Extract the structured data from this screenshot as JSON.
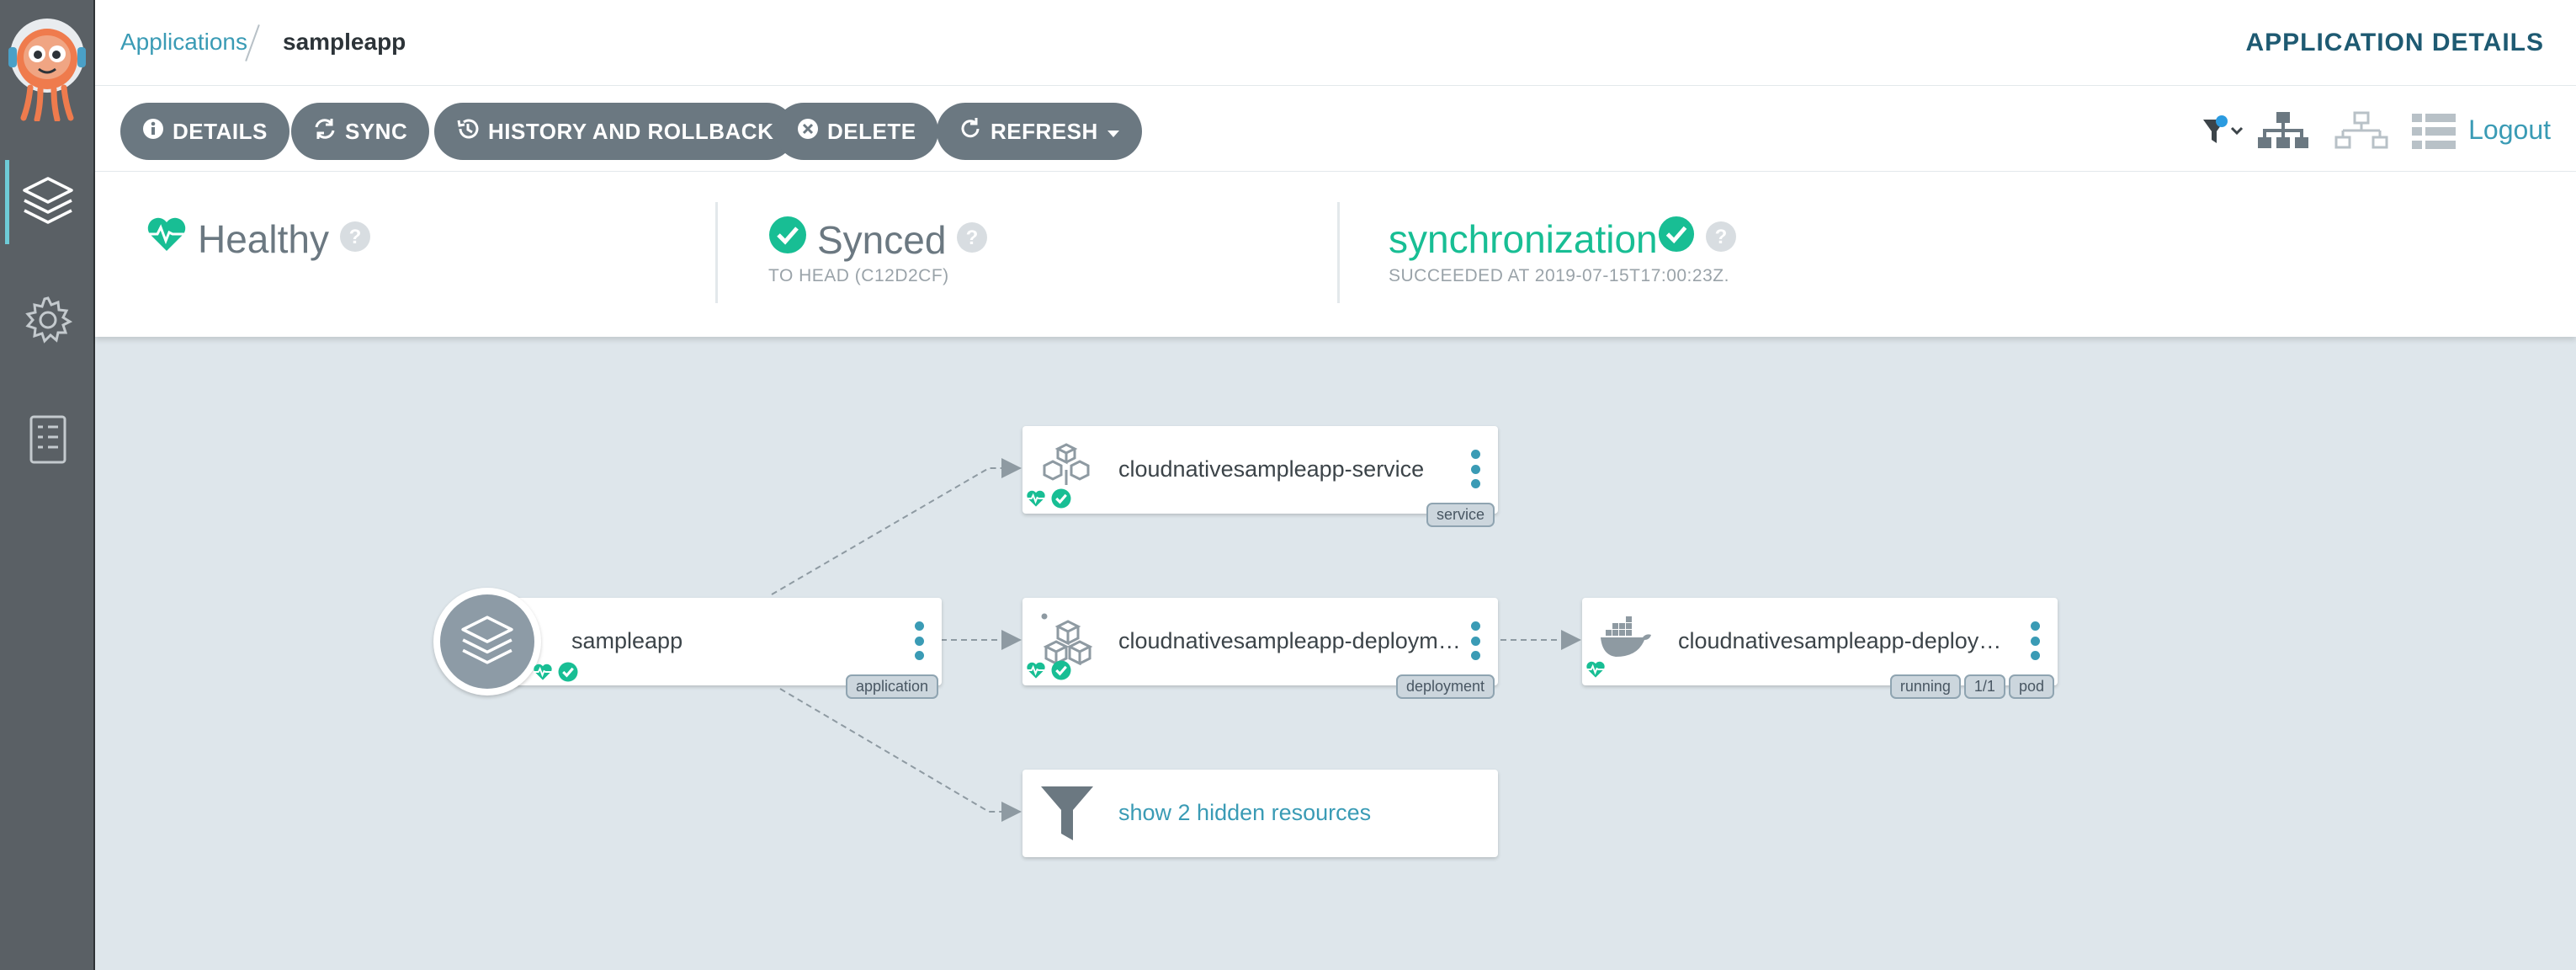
{
  "header": {
    "breadcrumb_link": "Applications",
    "breadcrumb_current": "sampleapp",
    "page_title": "APPLICATION DETAILS"
  },
  "sidebar": {
    "items": [
      {
        "icon": "layers-icon",
        "active": true
      },
      {
        "icon": "gear-icon",
        "active": false
      },
      {
        "icon": "docs-icon",
        "active": false
      }
    ]
  },
  "toolbar": {
    "buttons": [
      {
        "label": "DETAILS",
        "icon": "info-icon"
      },
      {
        "label": "SYNC",
        "icon": "sync-icon"
      },
      {
        "label": "HISTORY AND ROLLBACK",
        "icon": "history-icon"
      },
      {
        "label": "DELETE",
        "icon": "close-circle-icon"
      },
      {
        "label": "REFRESH",
        "icon": "refresh-icon"
      }
    ],
    "logout": "Logout"
  },
  "status": {
    "health": "Healthy",
    "sync": "Synced",
    "sync_sub": "TO HEAD (C12D2CF)",
    "operation": "synchronization",
    "operation_sub": "SUCCEEDED AT 2019-07-15T17:00:23Z."
  },
  "graph": {
    "app_node": {
      "label": "sampleapp",
      "tags": [
        "application"
      ]
    },
    "service_node": {
      "label": "cloudnativesampleapp-service",
      "tags": [
        "service"
      ]
    },
    "deployment_node": {
      "label": "cloudnativesampleapp-deployment",
      "tags": [
        "deployment"
      ]
    },
    "pod_node": {
      "label": "cloudnativesampleapp-deploymen...",
      "tags": [
        "running",
        "1/1",
        "pod"
      ]
    },
    "hidden_node": {
      "label": "show 2 hidden resources"
    }
  },
  "colors": {
    "accent": "#3a9bb5",
    "healthy": "#18be94",
    "button_bg": "#6b7881",
    "sidebar_bg": "#5a6065"
  }
}
